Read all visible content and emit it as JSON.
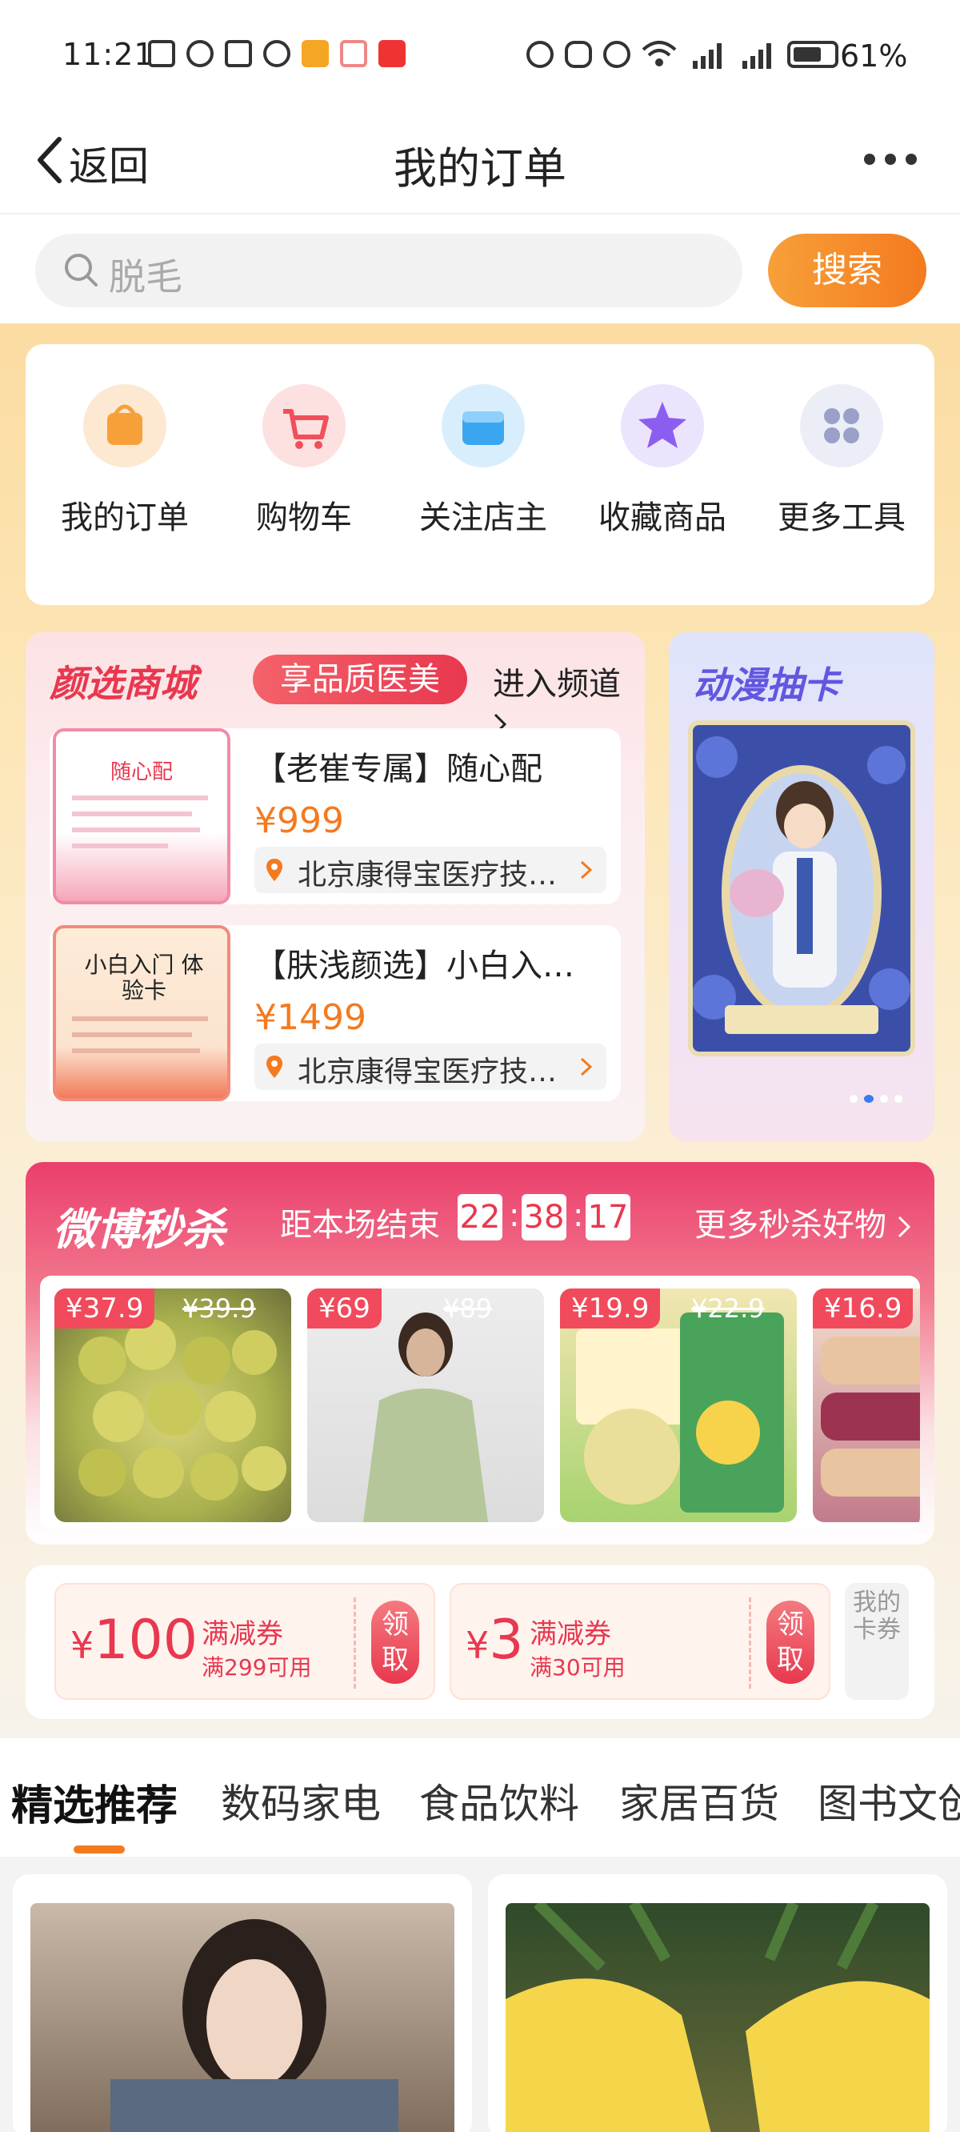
{
  "status_bar": {
    "time": "11:21",
    "battery": "61%",
    "icons": [
      "cast-icon",
      "eye-icon",
      "nfc-icon",
      "swoosh-icon",
      "weibo-icon",
      "app-icon",
      "bank-icon",
      "alarm-icon",
      "bluetooth-icon",
      "mute-icon",
      "wifi-icon",
      "signal-5g-icon",
      "signal-5g-icon",
      "battery-icon"
    ]
  },
  "header": {
    "back_label": "返回",
    "title": "我的订单"
  },
  "search": {
    "placeholder": "脱毛",
    "button_label": "搜索"
  },
  "tools": [
    {
      "label": "我的订单",
      "icon": "shopping-bag-icon",
      "color": "#f7a03a"
    },
    {
      "label": "购物车",
      "icon": "cart-icon",
      "color": "#f0505a"
    },
    {
      "label": "关注店主",
      "icon": "shop-icon",
      "color": "#3aa6f0"
    },
    {
      "label": "收藏商品",
      "icon": "star-icon",
      "color": "#8c5ef0"
    },
    {
      "label": "更多工具",
      "icon": "grid-icon",
      "color": "#9aa0c8"
    }
  ],
  "yanxuan": {
    "title": "颜选商城",
    "badge": "享品质医美",
    "link": "进入频道",
    "items": [
      {
        "title": "【老崔专属】随心配",
        "price": "¥999",
        "shop": "北京康得宝医疗技…",
        "thumb_text": "随心配"
      },
      {
        "title": "【肤浅颜选】小白入…",
        "price": "¥1499",
        "shop": "北京康得宝医疗技…",
        "thumb_text": "小白入门 体验卡"
      }
    ]
  },
  "anime": {
    "title": "动漫抽卡"
  },
  "flash_sale": {
    "title": "微博秒杀",
    "countdown_label": "距本场结束",
    "hours": "22",
    "minutes": "38",
    "seconds": "17",
    "more": "更多秒杀好物",
    "items": [
      {
        "price": "¥37.9",
        "old_price": "¥39.9"
      },
      {
        "price": "¥69",
        "old_price": "¥89"
      },
      {
        "price": "¥19.9",
        "old_price": "¥22.9"
      },
      {
        "price": "¥16.9",
        "old_price": ""
      }
    ]
  },
  "coupons": [
    {
      "currency": "¥",
      "amount": "100",
      "name": "满减券",
      "condition": "满299可用",
      "button": "领取"
    },
    {
      "currency": "¥",
      "amount": "3",
      "name": "满减券",
      "condition": "满30可用",
      "button": "领取"
    }
  ],
  "card_wallet": "我的卡券",
  "category_tabs": [
    "精选推荐",
    "数码家电",
    "食品饮料",
    "家居百货",
    "图书文创"
  ],
  "colors": {
    "accent": "#f47a1f",
    "flash_red": "#e8384f",
    "yanxuan_red": "#e8384f",
    "anime_purple": "#6257e0"
  }
}
